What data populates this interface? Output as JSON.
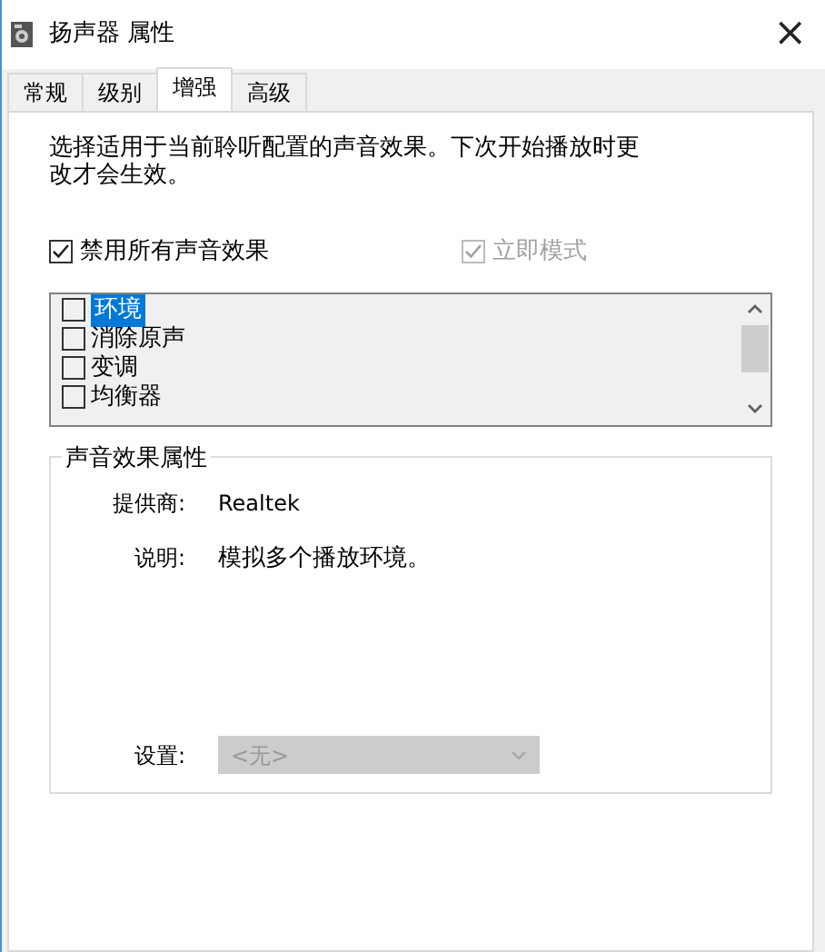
{
  "window": {
    "title": "扬声器 属性",
    "close": "×"
  },
  "tabs": [
    {
      "label": "常规",
      "selected": false
    },
    {
      "label": "级别",
      "selected": false
    },
    {
      "label": "增强",
      "selected": true
    },
    {
      "label": "高级",
      "selected": false
    }
  ],
  "description": "选择适用于当前聆听配置的声音效果。下次开始播放时更改才会生效。",
  "disable_all": {
    "label": "禁用所有声音效果",
    "checked": true,
    "disabled": false
  },
  "immediate_mode": {
    "label": "立即模式",
    "checked": true,
    "disabled": true
  },
  "effects": [
    {
      "label": "环境",
      "checked": false,
      "selected": true
    },
    {
      "label": "消除原声",
      "checked": false,
      "selected": false
    },
    {
      "label": "变调",
      "checked": false,
      "selected": false
    },
    {
      "label": "均衡器",
      "checked": false,
      "selected": false
    }
  ],
  "properties": {
    "title": "声音效果属性",
    "provider_label": "提供商:",
    "provider": "Realtek",
    "description_label": "说明:",
    "description": "模拟多个播放环境。",
    "settings_label": "设置:",
    "settings_value": "<无>",
    "settings_disabled": true
  }
}
